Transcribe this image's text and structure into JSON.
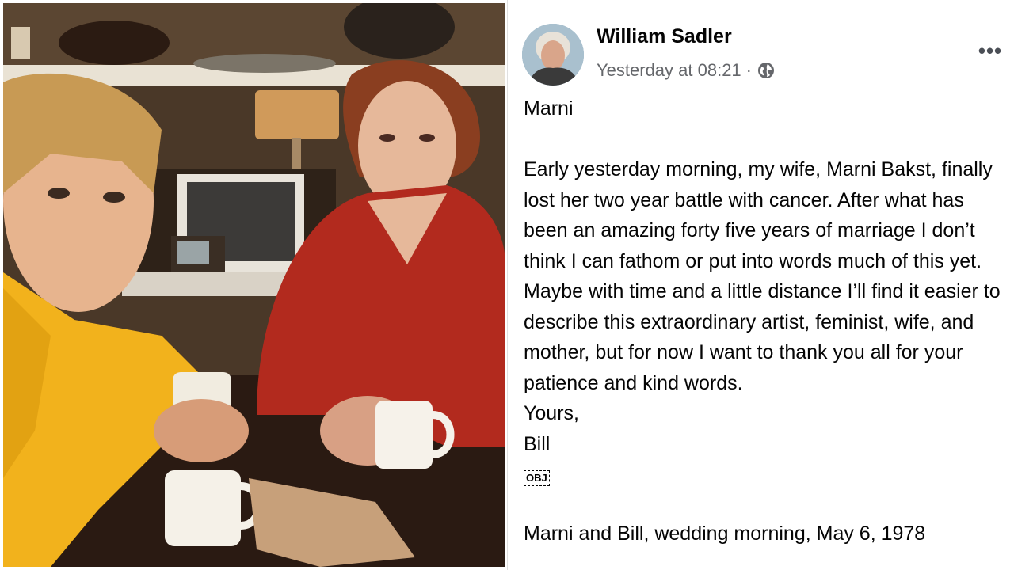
{
  "photo": {
    "description_icon": "photo-couple-image"
  },
  "post": {
    "author": "William Sadler",
    "timestamp": "Yesterday at 08:21",
    "separator": "·",
    "privacy_icon": "globe-icon",
    "more_label": "•••",
    "title": "Marni",
    "paragraph": "Early yesterday morning, my wife, Marni Bakst, finally lost her two year battle with cancer. After what has been an amazing forty five years of marriage I don’t think I can fathom or put into words much of this yet. Maybe with time and a little distance I’ll find it easier to describe this extraordinary artist, feminist, wife, and mother, but for now I want to thank you all for your patience and kind words.",
    "closing": "Yours,",
    "signature": "Bill",
    "obj_badge": "OBJ",
    "caption": "Marni and Bill, wedding morning, May 6, 1978"
  },
  "colors": {
    "text_primary": "#050505",
    "text_secondary": "#65676b",
    "background": "#ffffff"
  }
}
